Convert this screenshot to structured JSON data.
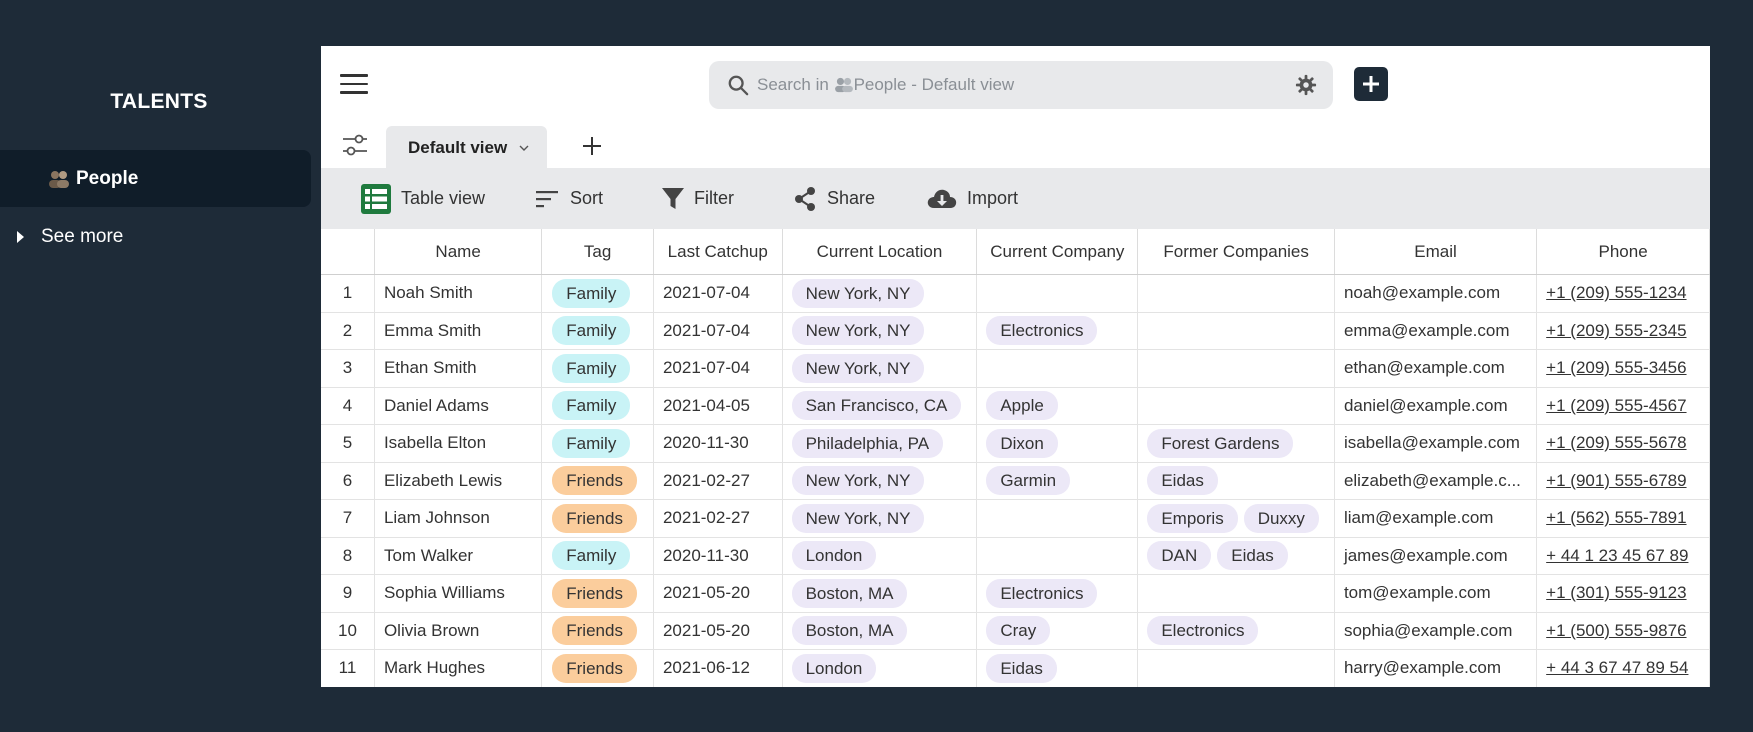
{
  "sidebar": {
    "title": "TALENTS",
    "items": [
      {
        "label": "People",
        "icon": "people-emoji-icon"
      }
    ],
    "see_more": "See more"
  },
  "header": {
    "search_prefix": "Search in",
    "search_target": "People - Default view",
    "views": [
      {
        "label": "Default view",
        "active": true
      }
    ]
  },
  "toolbar": {
    "table_view": "Table view",
    "sort": "Sort",
    "filter": "Filter",
    "share": "Share",
    "import": "Import"
  },
  "colors": {
    "background": "#1e2b38",
    "sidebar_active": "#101d29",
    "family_tag": "#c9f3f6",
    "friends_tag": "#fbcd9c",
    "chip": "#ece8f7",
    "table_view_icon": "#1f7a3e"
  },
  "table": {
    "columns": [
      "",
      "Name",
      "Tag",
      "Last Catchup",
      "Current Location",
      "Current Company",
      "Former Companies",
      "Email",
      "Phone"
    ],
    "rows": [
      {
        "num": "1",
        "name": "Noah Smith",
        "tag": "Family",
        "last": "2021-07-04",
        "location": "New York, NY",
        "company": "",
        "former": [],
        "email": "noah@example.com",
        "phone": "+1 (209) 555-1234"
      },
      {
        "num": "2",
        "name": "Emma Smith",
        "tag": "Family",
        "last": "2021-07-04",
        "location": "New York, NY",
        "company": "Electronics",
        "former": [],
        "email": "emma@example.com",
        "phone": "+1 (209) 555-2345"
      },
      {
        "num": "3",
        "name": "Ethan Smith",
        "tag": "Family",
        "last": "2021-07-04",
        "location": "New York, NY",
        "company": "",
        "former": [],
        "email": "ethan@example.com",
        "phone": "+1 (209) 555-3456"
      },
      {
        "num": "4",
        "name": "Daniel Adams",
        "tag": "Family",
        "last": "2021-04-05",
        "location": "San Francisco, CA",
        "company": "Apple",
        "former": [],
        "email": "daniel@example.com",
        "phone": "+1 (209) 555-4567"
      },
      {
        "num": "5",
        "name": "Isabella Elton",
        "tag": "Family",
        "last": "2020-11-30",
        "location": "Philadelphia, PA",
        "company": "Dixon",
        "former": [
          "Forest Gardens"
        ],
        "email": "isabella@example.com",
        "phone": "+1 (209) 555-5678"
      },
      {
        "num": "6",
        "name": "Elizabeth Lewis",
        "tag": "Friends",
        "last": "2021-02-27",
        "location": "New York, NY",
        "company": "Garmin",
        "former": [
          "Eidas"
        ],
        "email": "elizabeth@example.c...",
        "phone": "+1 (901) 555-6789"
      },
      {
        "num": "7",
        "name": "Liam Johnson",
        "tag": "Friends",
        "last": "2021-02-27",
        "location": "New York, NY",
        "company": "",
        "former": [
          "Emporis",
          "Duxxy"
        ],
        "email": "liam@example.com",
        "phone": "+1 (562) 555-7891"
      },
      {
        "num": "8",
        "name": "Tom Walker",
        "tag": "Family",
        "last": "2020-11-30",
        "location": "London",
        "company": "",
        "former": [
          "DAN",
          "Eidas"
        ],
        "email": "james@example.com",
        "phone": "+ 44 1 23 45 67 89"
      },
      {
        "num": "9",
        "name": "Sophia Williams",
        "tag": "Friends",
        "last": "2021-05-20",
        "location": "Boston, MA",
        "company": "Electronics",
        "former": [],
        "email": "tom@example.com",
        "phone": "+1 (301) 555-9123"
      },
      {
        "num": "10",
        "name": "Olivia Brown",
        "tag": "Friends",
        "last": "2021-05-20",
        "location": "Boston, MA",
        "company": "Cray",
        "former": [
          "Electronics"
        ],
        "email": "sophia@example.com",
        "phone": "+1 (500) 555-9876"
      },
      {
        "num": "11",
        "name": "Mark Hughes",
        "tag": "Friends",
        "last": "2021-06-12",
        "location": "London",
        "company": "Eidas",
        "former": [],
        "email": "harry@example.com",
        "phone": "+ 44 3 67 47 89 54"
      }
    ]
  }
}
